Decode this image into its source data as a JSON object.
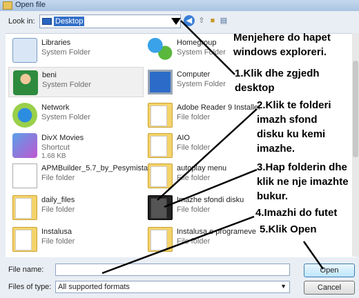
{
  "window": {
    "title": "Open file"
  },
  "lookin": {
    "label": "Look in:",
    "value": "Desktop"
  },
  "items": [
    {
      "name": "Libraries",
      "type": "System Folder",
      "size": "",
      "icon": "libraries-icon"
    },
    {
      "name": "Homegroup",
      "type": "System Folder",
      "size": "",
      "icon": "homegroup-icon"
    },
    {
      "name": "beni",
      "type": "System Folder",
      "size": "",
      "icon": "user-icon"
    },
    {
      "name": "Computer",
      "type": "System Folder",
      "size": "",
      "icon": "computer-icon"
    },
    {
      "name": "Network",
      "type": "System Folder",
      "size": "",
      "icon": "network-icon"
    },
    {
      "name": "Adobe Reader 9 Installer",
      "type": "File folder",
      "size": "",
      "icon": "folder-icon"
    },
    {
      "name": "DivX Movies",
      "type": "Shortcut",
      "size": "1.68 KB",
      "icon": "divx-shortcut-icon"
    },
    {
      "name": "AIO",
      "type": "File folder",
      "size": "",
      "icon": "folder-icon"
    },
    {
      "name": "APMBuilder_5.7_by_Pesymista",
      "type": "File folder",
      "size": "",
      "icon": "folder-icon"
    },
    {
      "name": "autoplay menu",
      "type": "File folder",
      "size": "",
      "icon": "folder-icon"
    },
    {
      "name": "daily_files",
      "type": "File folder",
      "size": "",
      "icon": "folder-icon"
    },
    {
      "name": "Imazhe sfondi disku",
      "type": "File folder",
      "size": "",
      "icon": "folder-dark-icon"
    },
    {
      "name": "Instalusa",
      "type": "File folder",
      "size": "",
      "icon": "folder-icon"
    },
    {
      "name": "Instalusa e programeve",
      "type": "File folder",
      "size": "",
      "icon": "folder-icon"
    }
  ],
  "bottom": {
    "filename_label": "File name:",
    "filename_value": "",
    "filetype_label": "Files of type:",
    "filetype_value": "All supported formats",
    "open_label": "Open",
    "cancel_label": "Cancel"
  },
  "annotations": {
    "a0a": "Menjehere do hapet",
    "a0b": "windows exploreri.",
    "a1a": "1.Klik dhe zgjedh",
    "a1b": "desktop",
    "a2a": "2.Klik te folderi",
    "a2b": "imazh sfond",
    "a2c": "disku ku kemi",
    "a2d": "imazhe.",
    "a3a": "3.Hap folderin dhe",
    "a3b": "klik ne nje imazhte",
    "a3c": "bukur.",
    "a4": "4.Imazhi do futet",
    "a5": "5.Klik Open"
  }
}
